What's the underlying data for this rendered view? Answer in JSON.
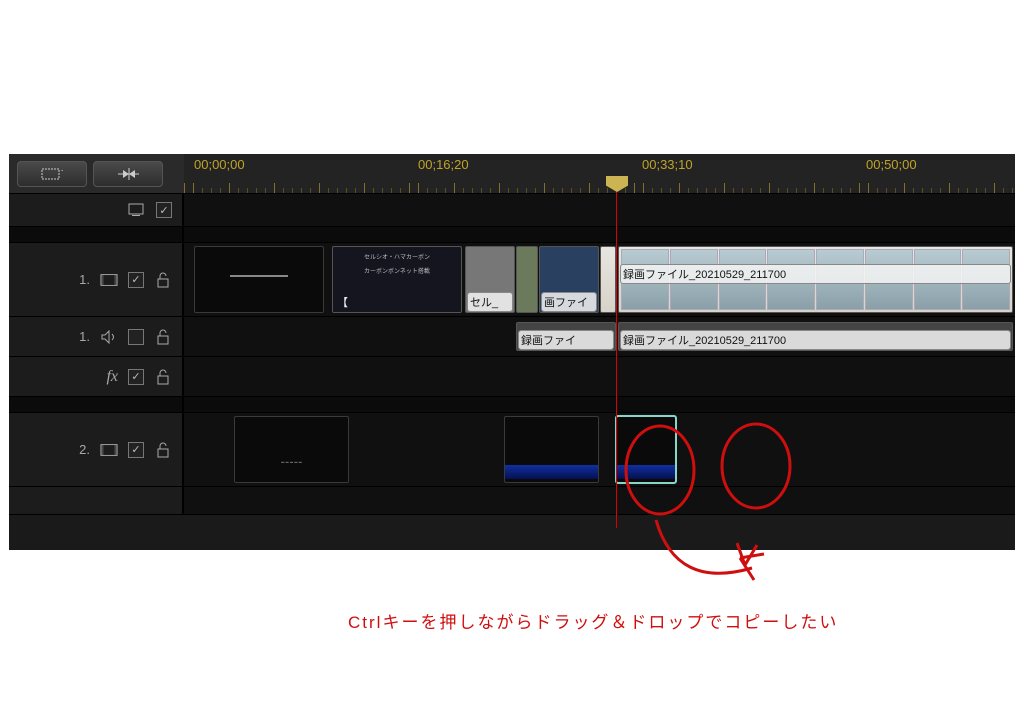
{
  "timecodes": [
    "00;00;00",
    "00;16;20",
    "00;33;10",
    "00;50;00"
  ],
  "tracks": {
    "header": {
      "label": ""
    },
    "video1": {
      "num": "1.",
      "clips": {
        "c3_label": "セル_",
        "c4_label": "画ファイ",
        "c5_label": "録画ファイル_20210529_211700"
      }
    },
    "audio1": {
      "num": "1.",
      "clips": {
        "a1_label": "録画ファイ",
        "a2_label": "録画ファイル_20210529_211700"
      }
    },
    "video2": {
      "num": "2."
    }
  },
  "annotation": "Ctrlキーを押しながらドラッグ＆ドロップでコピーしたい"
}
